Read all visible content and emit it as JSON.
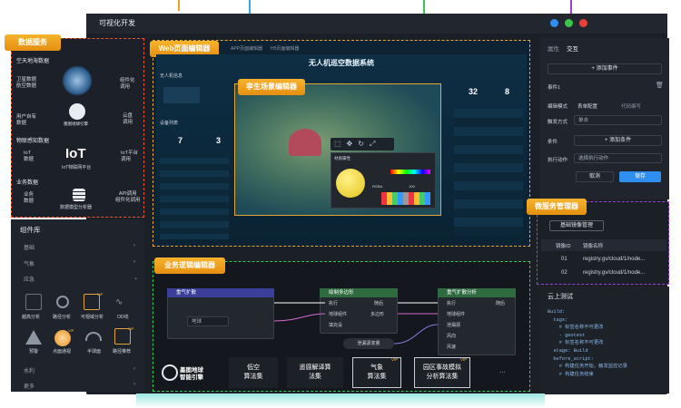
{
  "window": {
    "title": "可视化开发"
  },
  "tags": {
    "data_service": "数据服务",
    "web_editor": "Web页面编辑器",
    "scene_editor": "孪生场景编辑器",
    "biz_editor": "业务逻辑编辑器",
    "micro_manager": "微服务管理器"
  },
  "data_panel": {
    "sec1": "空天地海数据",
    "items": [
      {
        "left": "卫星数据\n航空数据",
        "right": "组件化\n调用"
      },
      {
        "left": "用户自有\n数据",
        "center": "墨图地球引擎",
        "right": "云盘\n调用"
      }
    ],
    "sec2": "物联感知数据",
    "iot": {
      "left": "IoT\n数据",
      "center_logo": "IoT",
      "center": "IoT物联网平台",
      "right": "IoT平台\n调用"
    },
    "sec3": "业务数据",
    "biz": {
      "left": "业务\n数据",
      "center": "数据模型分析器",
      "right": "API调用\n组件化调用"
    }
  },
  "components": {
    "title": "组件库",
    "cats": [
      "基础",
      "气象",
      "应急",
      "水利",
      "更多"
    ],
    "grid": [
      {
        "label": "越高分析",
        "icon": "ruler-icon"
      },
      {
        "label": "路径分析",
        "icon": "route-icon"
      },
      {
        "label": "可视域分析",
        "icon": "viewshed-icon",
        "vip": "VIP"
      },
      {
        "label": "OD线",
        "icon": "odline-icon"
      },
      {
        "label": "预警",
        "icon": "warning-icon"
      },
      {
        "label": "点面通视",
        "icon": "sphere-icon",
        "vip": "VIP"
      },
      {
        "label": "半球面",
        "icon": "hemisphere-icon"
      },
      {
        "label": "路径推荐",
        "icon": "map-pin-icon",
        "vip": "VIP"
      }
    ]
  },
  "right_panel": {
    "tabs": [
      "属性",
      "交互"
    ],
    "add_event": "+ 添加事件",
    "event": "事件1",
    "edit_mode_label": "编辑模式",
    "mode_a": "表单配置",
    "mode_b": "代码编写",
    "trigger_label": "触发方式",
    "trigger_value": "单击",
    "cond_label": "条件",
    "cond_btn": "+ 添加条件",
    "action_label": "执行动作",
    "action_value": "选择执行动作",
    "cancel": "取消",
    "save": "保存"
  },
  "manager": {
    "button": "基础镜像管理",
    "col_id": "镜像ID",
    "col_name": "镜像名称",
    "rows": [
      {
        "id": "01",
        "name": "registry.gv/cloud/1/node..."
      },
      {
        "id": "02",
        "name": "registry.gv/cloud/1/node..."
      }
    ]
  },
  "cloud": {
    "title": "云上测试",
    "lines": [
      "Build:",
      "  tags:",
      "    # 标签名称不可更改",
      "    - geotest",
      "    # 标签名称不可更改",
      "  stage: Build",
      "  before_script:",
      "    # 构建任务开始，触发监控记录",
      "    # 构建任务结束"
    ]
  },
  "scene": {
    "tabs": [
      "APP页面编辑器",
      "H5页面编辑器"
    ],
    "title": "无人机巡空数据系统",
    "left_hdr": "无人机信息",
    "left_list_title": "设备列表",
    "stat1": "7",
    "stat2": "3",
    "stat3": "32",
    "stat4": "8",
    "picker_title": "材质属性",
    "picker_label": "RGBA",
    "picker_value": "100"
  },
  "logic": {
    "node1": "重气扩散",
    "node2": "绘制多边形",
    "node3": "重气扩散分析",
    "ports_exec": "执行",
    "ports_after": "随后",
    "port_poly": "多边形",
    "port_fill": "填充设",
    "port_area": "地球组件",
    "port_src": "泄漏源",
    "port_wind": "风向",
    "port_speed": "风速",
    "select_value": "地球",
    "leak_node": "泄漏源变量",
    "logo_line1": "墨图地球",
    "logo_line2": "智能引擎",
    "algos": [
      "低空\n算法集",
      "遥感解译算\n法集",
      "气象\n算法集",
      "园区事故模拟\n分析算法集"
    ],
    "more": "...",
    "vip": "VIP"
  }
}
